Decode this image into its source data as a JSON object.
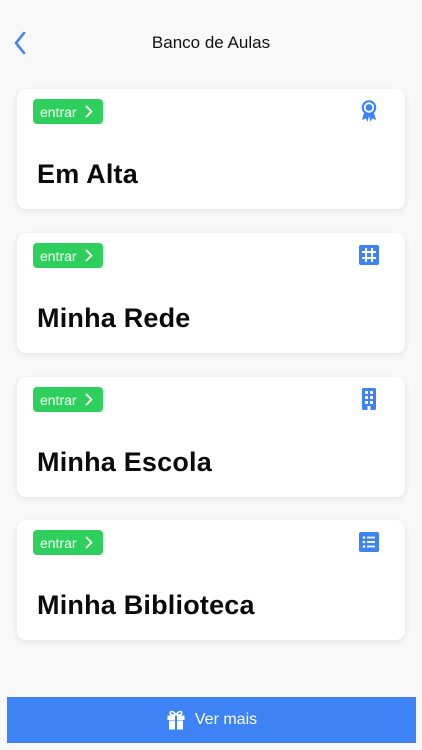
{
  "header": {
    "title": "Banco de Aulas"
  },
  "cards": [
    {
      "badge_label": "entrar",
      "title": "Em Alta",
      "icon": "award-ribbon-icon"
    },
    {
      "badge_label": "entrar",
      "title": "Minha Rede",
      "icon": "grid-icon"
    },
    {
      "badge_label": "entrar",
      "title": "Minha Escola",
      "icon": "building-icon"
    },
    {
      "badge_label": "entrar",
      "title": "Minha Biblioteca",
      "icon": "list-icon"
    }
  ],
  "footer": {
    "button_label": "Ver mais",
    "icon": "gift-icon"
  },
  "colors": {
    "accent": "#3d83f6",
    "badge": "#2fcf5e",
    "background": "#f8f8f8"
  }
}
